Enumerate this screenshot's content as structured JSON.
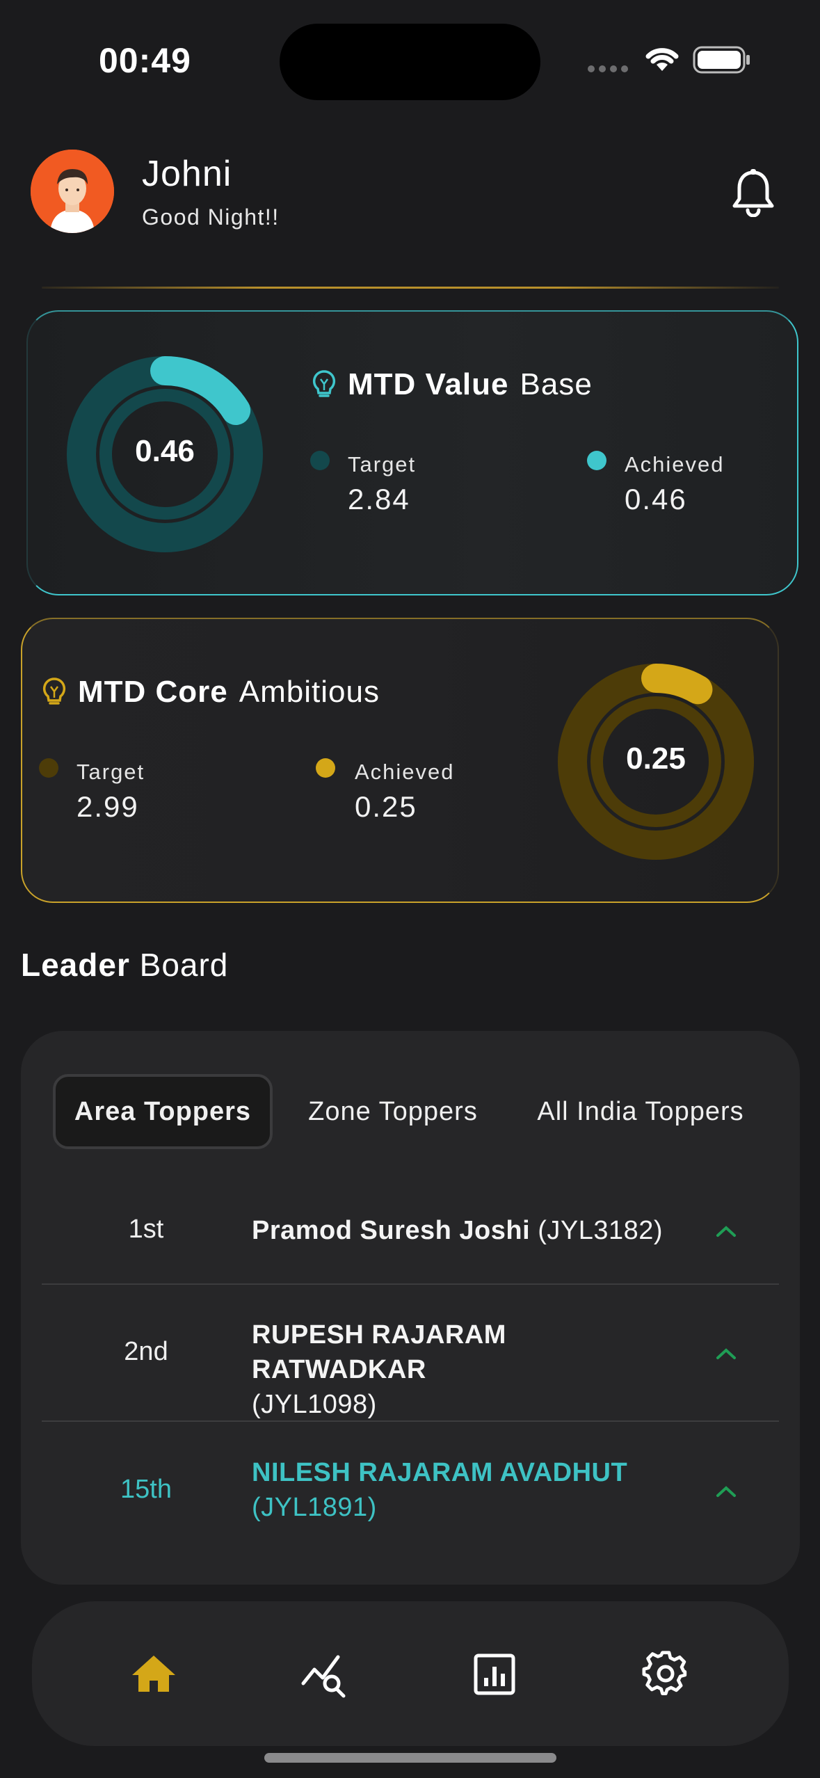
{
  "status_bar": {
    "time": "00:49"
  },
  "header": {
    "user_name": "Johni",
    "greeting": "Good Night!!"
  },
  "mtd_value": {
    "title_bold": "MTD Value",
    "title_light": "Base",
    "center_value": "0.46",
    "target_label": "Target",
    "target_value": "2.84",
    "achieved_label": "Achieved",
    "achieved_value": "0.46",
    "progress_fraction": 0.162,
    "accent_color": "#3fc6cc",
    "track_color": "#13484c"
  },
  "mtd_core": {
    "title_bold": "MTD Core",
    "title_light": "Ambitious",
    "center_value": "0.25",
    "target_label": "Target",
    "target_value": "2.99",
    "achieved_label": "Achieved",
    "achieved_value": "0.25",
    "progress_fraction": 0.084,
    "accent_color": "#d4a718",
    "track_color": "#4d3c08"
  },
  "leaderboard": {
    "title_bold": "Leader",
    "title_light": "Board",
    "tabs": [
      {
        "label": "Area Toppers",
        "active": true
      },
      {
        "label": "Zone Toppers",
        "active": false
      },
      {
        "label": "All India Toppers",
        "active": false
      }
    ],
    "rows": [
      {
        "rank": "1st",
        "name": "Pramod Suresh Joshi",
        "code": "(JYL3182)"
      },
      {
        "rank": "2nd",
        "name": "RUPESH RAJARAM RATWADKAR",
        "code": "(JYL1098)"
      },
      {
        "rank": "15th",
        "name": "NILESH RAJARAM AVADHUT",
        "code": "(JYL1891)",
        "is_current_user": true
      }
    ]
  },
  "bottom_nav": {
    "items": [
      {
        "icon": "home-icon",
        "active": true
      },
      {
        "icon": "analytics-search-icon",
        "active": false
      },
      {
        "icon": "report-chart-icon",
        "active": false
      },
      {
        "icon": "settings-gear-icon",
        "active": false
      }
    ],
    "active_color": "#d4a718"
  }
}
